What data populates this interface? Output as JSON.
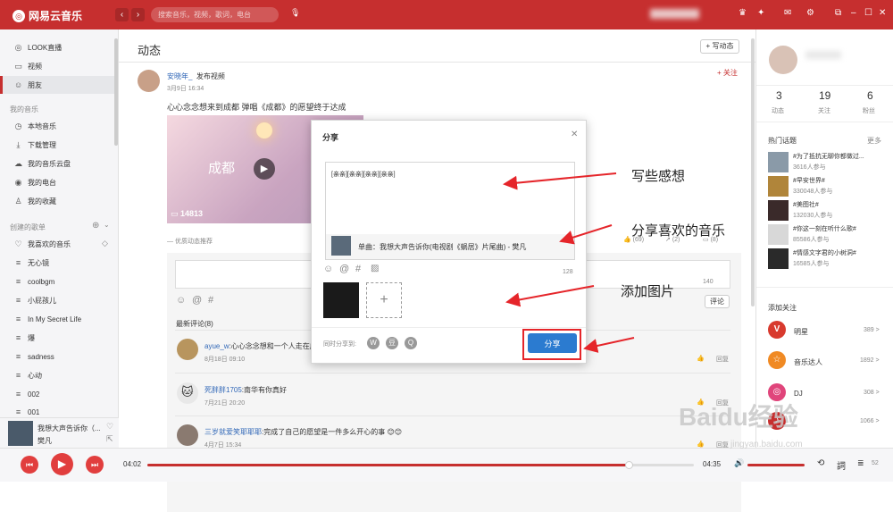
{
  "app": {
    "name": "网易云音乐",
    "search_placeholder": "搜索音乐，视频，歌词，电台"
  },
  "sidebar": {
    "items": [
      {
        "label": "LOOK直播",
        "icon": "live-icon"
      },
      {
        "label": "视频",
        "icon": "video-icon"
      },
      {
        "label": "朋友",
        "icon": "friends-icon"
      }
    ],
    "my_music_title": "我的音乐",
    "my_music": [
      {
        "label": "本地音乐"
      },
      {
        "label": "下载管理"
      },
      {
        "label": "我的音乐云盘"
      },
      {
        "label": "我的电台"
      },
      {
        "label": "我的收藏"
      }
    ],
    "playlists_title": "创建的歌单",
    "playlists": [
      {
        "label": "我喜欢的音乐"
      },
      {
        "label": "无心镜"
      },
      {
        "label": "coolbgm"
      },
      {
        "label": "小屁孩儿"
      },
      {
        "label": "In My Secret Life"
      },
      {
        "label": "爆"
      },
      {
        "label": "sadness"
      },
      {
        "label": "心动"
      },
      {
        "label": "002"
      },
      {
        "label": "001"
      }
    ]
  },
  "now_playing": {
    "title": "我想大声告诉你（...",
    "artist": "樊凡"
  },
  "main": {
    "title": "动态",
    "write_button": "写动态",
    "post": {
      "author": "安晓年_",
      "action": "发布视频",
      "date": "3月9日 16:34",
      "follow": "关注",
      "text": "心心念念想来到成都 弹唱《成都》的愿望终于达成",
      "video_title": "成都",
      "views": "14813",
      "recommend": "优质动态推荐",
      "likes": "(69)",
      "shares": "(2)",
      "comments": "(8)"
    },
    "comment_count": "140",
    "comment_button": "评论",
    "latest_title": "最新评论(8)",
    "comments": [
      {
        "user": "ayue_w",
        "text": ":心心念念想和一个人走在成",
        "date": "8月18日 09:10",
        "reply": "回复"
      },
      {
        "user": "死胖胖1705",
        "text": ":南华有你真好",
        "date": "7月21日 20:20",
        "reply": "回复"
      },
      {
        "user": "三岁就爱笑耶耶耶",
        "text": ":完成了自己的愿望是一件多么开心的事",
        "date": "4月7日 15:34",
        "reply": "回复"
      }
    ]
  },
  "dialog": {
    "title": "分享",
    "text": "[亲亲][亲亲][亲亲][亲亲]",
    "song": "单曲：我想大声告诉你(电视剧《蜗居》片尾曲) - 樊凡",
    "count": "128",
    "sync_label": "同时分享到:",
    "share_button": "分享"
  },
  "annotations": {
    "a1": "写些感想",
    "a2": "分享喜欢的音乐",
    "a3": "添加图片"
  },
  "right": {
    "stats": [
      {
        "value": "3",
        "label": "动态"
      },
      {
        "value": "19",
        "label": "关注"
      },
      {
        "value": "6",
        "label": "粉丝"
      }
    ],
    "hot_title": "热门话题",
    "more": "更多",
    "topics": [
      {
        "title": "#为了抵抗无聊你都做过...",
        "count": "3616人参与"
      },
      {
        "title": "#早安世界#",
        "count": "330048人参与"
      },
      {
        "title": "#美图社#",
        "count": "132030人参与"
      },
      {
        "title": "#你这一刻在听什么歌#",
        "count": "85586人参与"
      },
      {
        "title": "#情感文字君的小树洞#",
        "count": "16585人参与"
      }
    ],
    "follow_title": "添加关注",
    "follows": [
      {
        "name": "明星",
        "count": "389 >",
        "color": "#d83a2e"
      },
      {
        "name": "音乐达人",
        "count": "1892 >",
        "color": "#f08a24"
      },
      {
        "name": "DJ",
        "count": "308 >",
        "color": "#e0457b"
      },
      {
        "name": "",
        "count": "1066 >",
        "color": "#c62f2f"
      }
    ]
  },
  "player": {
    "current": "04:02",
    "total": "04:35",
    "progress": 0.88,
    "playlist_count": "52"
  },
  "watermark": {
    "brand": "Baidu经验",
    "url": "jingyan.baidu.com"
  }
}
